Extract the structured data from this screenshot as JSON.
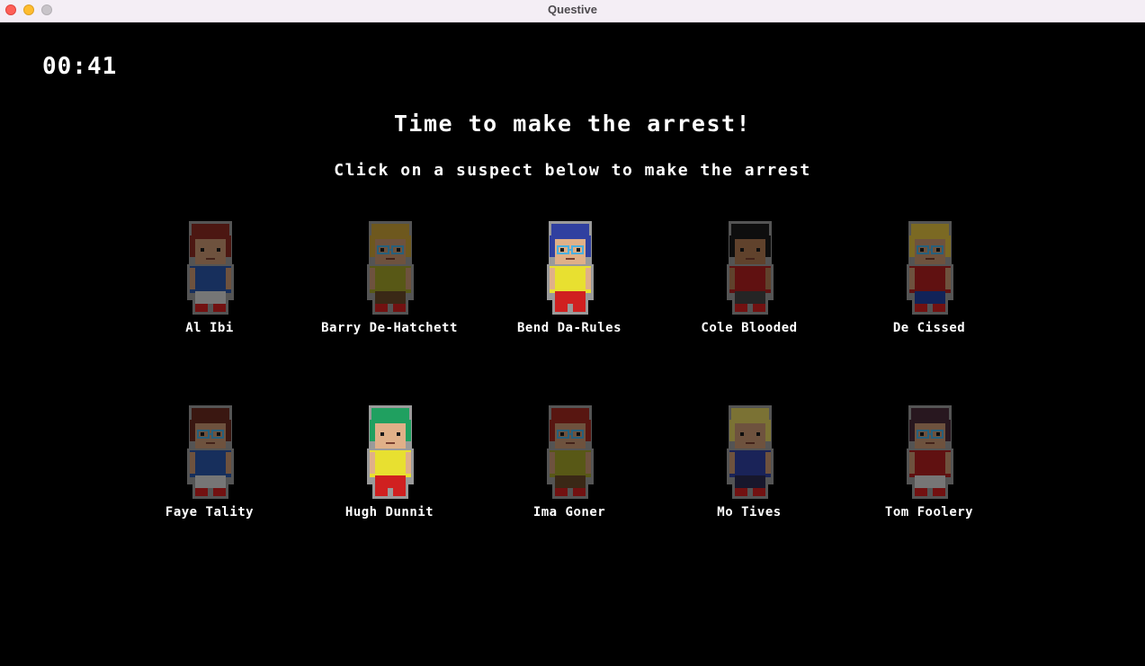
{
  "window": {
    "title": "Questive"
  },
  "game": {
    "timer": "00:41",
    "headline": "Time to make the arrest!",
    "instruction": "Click on a suspect below to make the arrest"
  },
  "suspects": [
    {
      "name": "Al Ibi",
      "hair": "#8a2a22",
      "shirt": "#2a56a8",
      "pants": "#d8d8d8",
      "skin": "#c89672",
      "glasses": false,
      "dimmed": true
    },
    {
      "name": "Barry De-Hatchett",
      "hair": "#c8a038",
      "shirt": "#a0a028",
      "pants": "#6a4a28",
      "skin": "#c89672",
      "glasses": true,
      "dimmed": true
    },
    {
      "name": "Bend Da-Rules",
      "hair": "#3040a0",
      "shirt": "#e8e030",
      "pants": "#d02020",
      "skin": "#e0b088",
      "glasses": true,
      "dimmed": false
    },
    {
      "name": "Cole Blooded",
      "hair": "#1a1a1a",
      "shirt": "#b02020",
      "pants": "#444444",
      "skin": "#b07850",
      "glasses": false,
      "dimmed": true
    },
    {
      "name": "De Cissed",
      "hair": "#e0c040",
      "shirt": "#b02020",
      "pants": "#2040a0",
      "skin": "#c89672",
      "glasses": true,
      "dimmed": true
    },
    {
      "name": "Faye Tality",
      "hair": "#6a2a20",
      "shirt": "#2a56a8",
      "pants": "#d8d8d8",
      "skin": "#c89672",
      "glasses": true,
      "dimmed": true
    },
    {
      "name": "Hugh Dunnit",
      "hair": "#20a060",
      "shirt": "#e8e030",
      "pants": "#d02020",
      "skin": "#e0b088",
      "glasses": false,
      "dimmed": false
    },
    {
      "name": "Ima Goner",
      "hair": "#a02820",
      "shirt": "#a0a028",
      "pants": "#6a4a28",
      "skin": "#c89672",
      "glasses": true,
      "dimmed": true
    },
    {
      "name": "Mo Tives",
      "hair": "#e0d060",
      "shirt": "#3040a0",
      "pants": "#2a2a50",
      "skin": "#c89672",
      "glasses": false,
      "dimmed": true
    },
    {
      "name": "Tom Foolery",
      "hair": "#4a2a3a",
      "shirt": "#b02020",
      "pants": "#d8d8d8",
      "skin": "#c89672",
      "glasses": true,
      "dimmed": true
    }
  ]
}
